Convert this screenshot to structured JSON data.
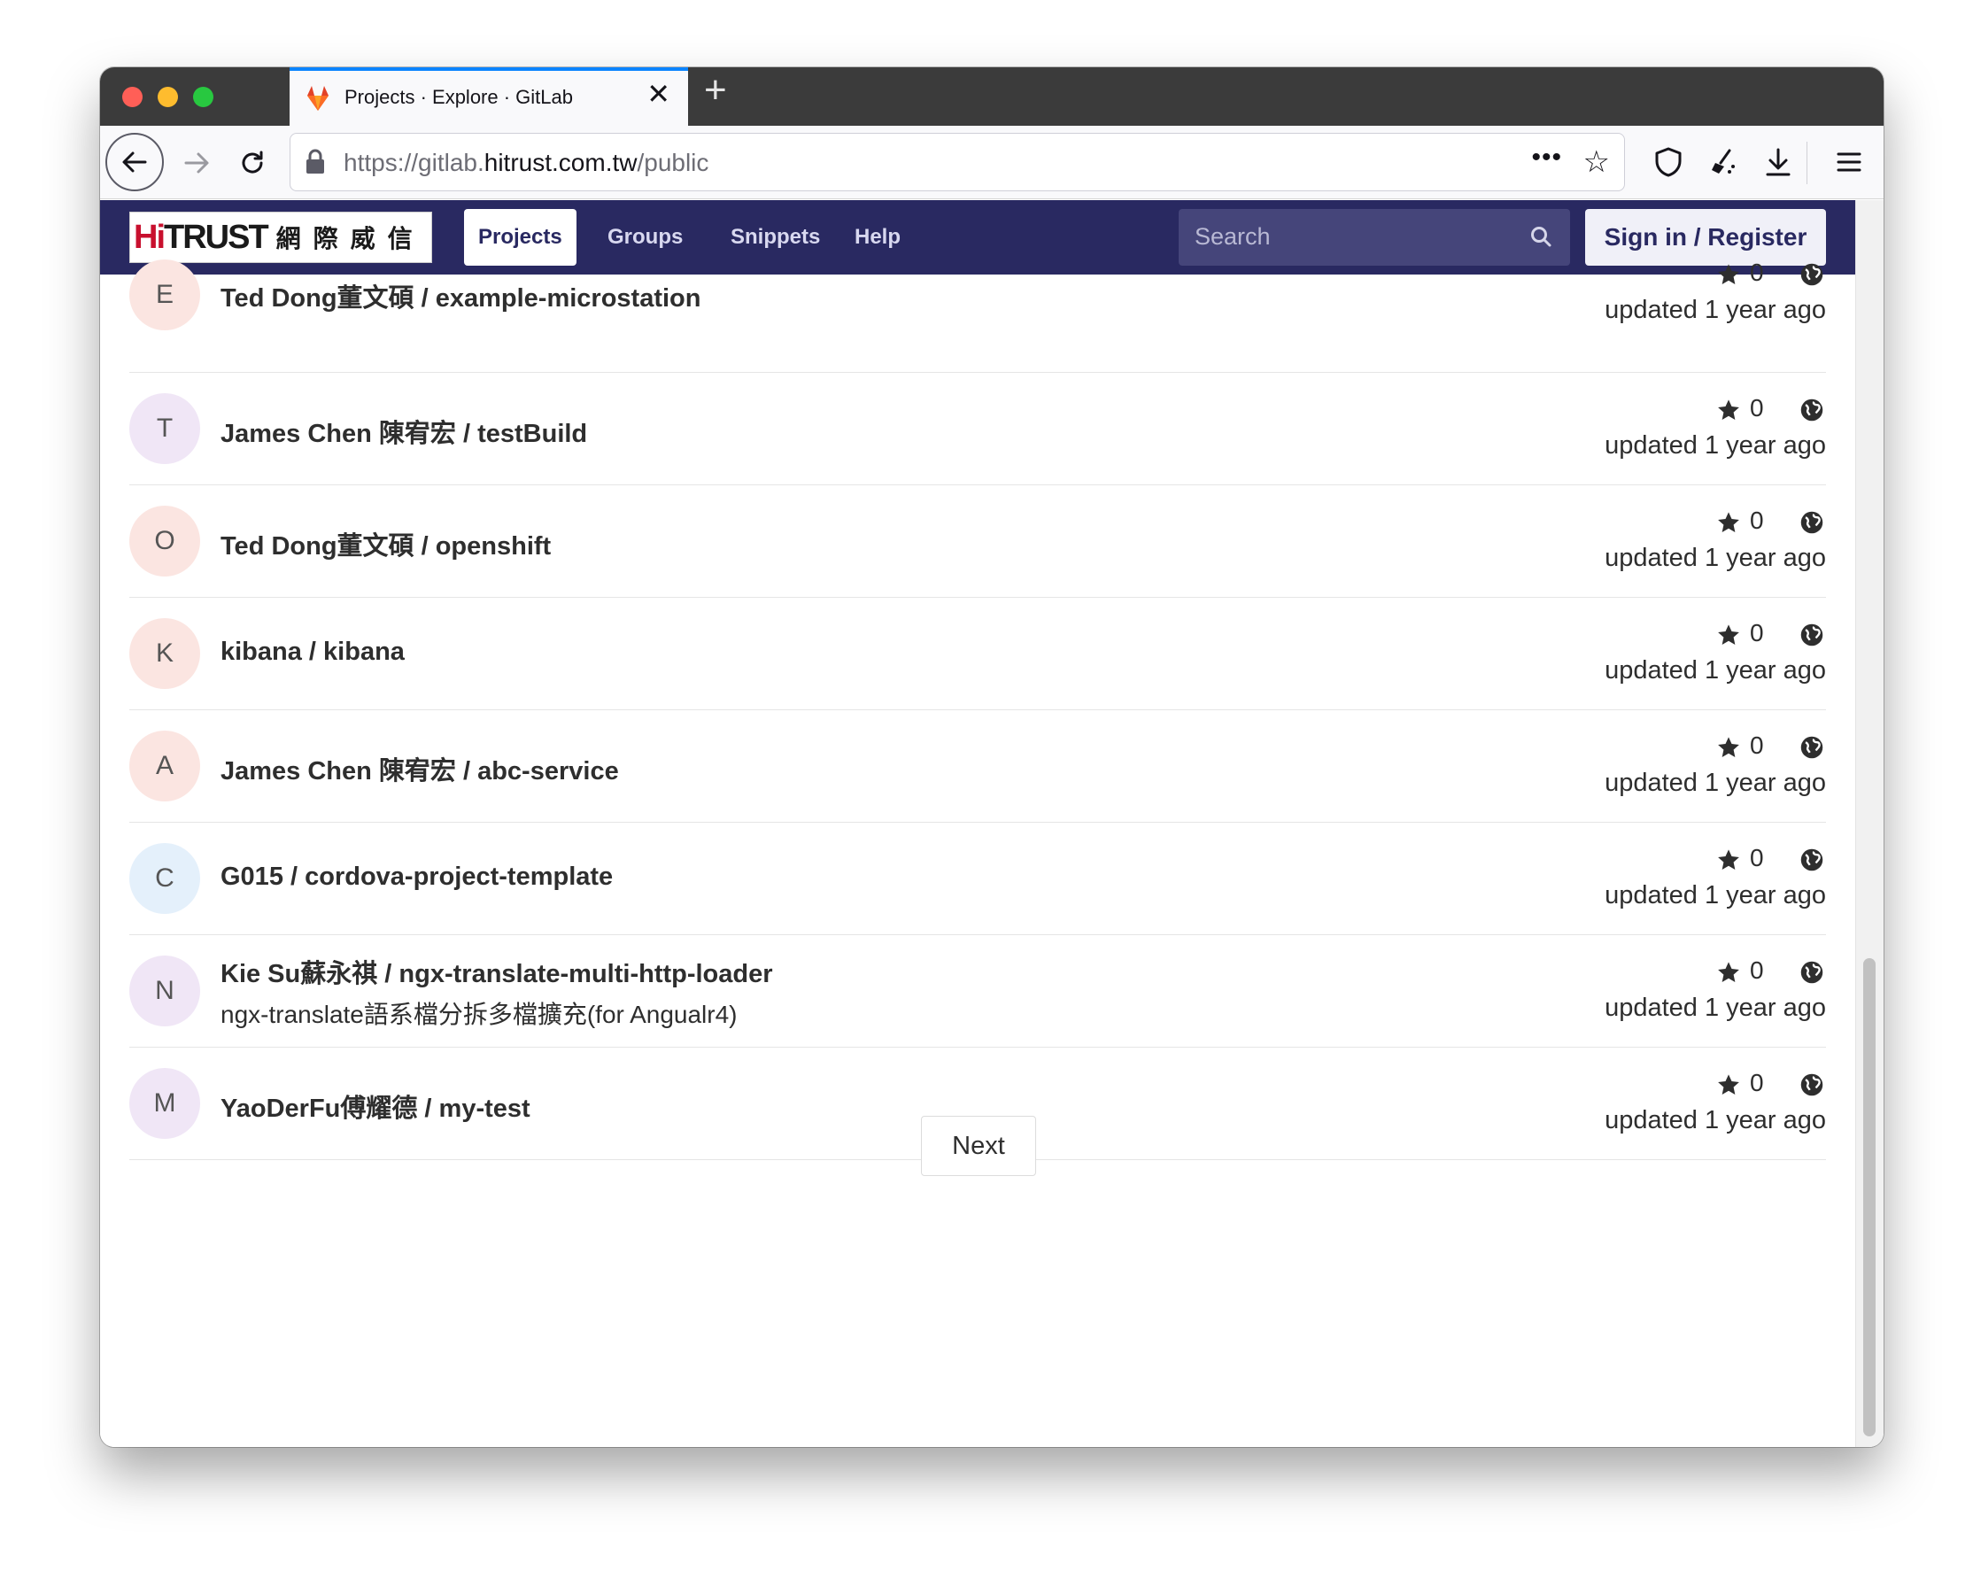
{
  "browser": {
    "tab_title": "Projects · Explore · GitLab",
    "url_prefix": "https://gitlab.",
    "url_domain": "hitrust.com.tw",
    "url_path": "/public",
    "new_tab_label": "+",
    "tab_close_label": "✕"
  },
  "navbar": {
    "logo_brand_hi": "Hi",
    "logo_brand_rest": "TRUST",
    "logo_cjk": "網際威信",
    "links": [
      "Projects",
      "Groups",
      "Snippets",
      "Help"
    ],
    "active_link": "Projects",
    "search_placeholder": "Search",
    "signin_label": "Sign in / Register"
  },
  "projects": [
    {
      "avatar": "E",
      "avatar_bg": "#fbe5e1",
      "name": "Ted Dong董文碩 / example-microstation",
      "description": "",
      "stars": "0",
      "updated": "updated 1 year ago"
    },
    {
      "avatar": "T",
      "avatar_bg": "#f0e6f6",
      "name": "James Chen 陳宥宏 / testBuild",
      "description": "",
      "stars": "0",
      "updated": "updated 1 year ago"
    },
    {
      "avatar": "O",
      "avatar_bg": "#fbe5e1",
      "name": "Ted Dong董文碩 / openshift",
      "description": "",
      "stars": "0",
      "updated": "updated 1 year ago"
    },
    {
      "avatar": "K",
      "avatar_bg": "#fbe5e1",
      "name": "kibana / kibana",
      "description": "",
      "stars": "0",
      "updated": "updated 1 year ago"
    },
    {
      "avatar": "A",
      "avatar_bg": "#fbe5e1",
      "name": "James Chen 陳宥宏 / abc-service",
      "description": "",
      "stars": "0",
      "updated": "updated 1 year ago"
    },
    {
      "avatar": "C",
      "avatar_bg": "#e4f0fb",
      "name": "G015 / cordova-project-template",
      "description": "",
      "stars": "0",
      "updated": "updated 1 year ago"
    },
    {
      "avatar": "N",
      "avatar_bg": "#f0e6f6",
      "name": "Kie Su蘇永祺 / ngx-translate-multi-http-loader",
      "description": "ngx-translate語系檔分拆多檔擴充(for Angualr4)",
      "stars": "0",
      "updated": "updated 1 year ago"
    },
    {
      "avatar": "M",
      "avatar_bg": "#f0e6f6",
      "name": "YaoDerFu傅耀德 / my-test",
      "description": "",
      "stars": "0",
      "updated": "updated 1 year ago"
    }
  ],
  "pagination": {
    "next_label": "Next"
  },
  "colors": {
    "navbar": "#292961",
    "accent": "#0a84ff",
    "brand_red": "#c8102e"
  }
}
